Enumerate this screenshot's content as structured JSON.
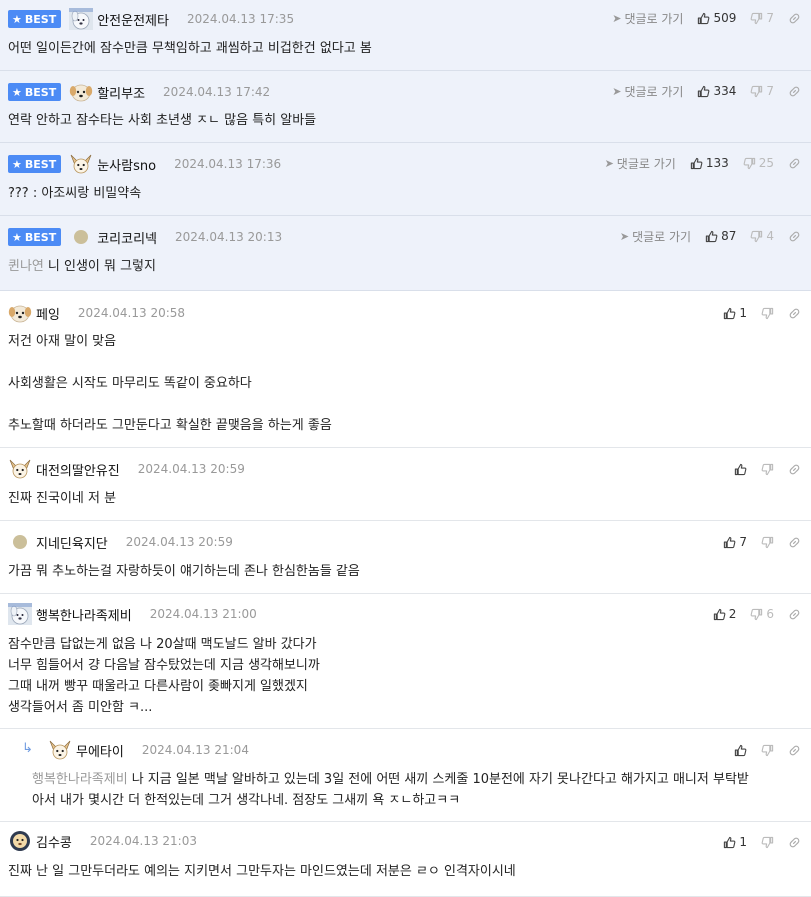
{
  "labels": {
    "best": "BEST",
    "reply_link": "댓글로 가기"
  },
  "comments": [
    {
      "nick": "안전운전제타",
      "time": "2024.04.13 17:35",
      "up": "509",
      "down": "7",
      "avatar": "white-dog",
      "lines": [
        "어떤 일이든간에 잠수만큼 무책임하고 괘씸하고 비겁한건 없다고 봄"
      ]
    },
    {
      "nick": "할리부조",
      "time": "2024.04.13 17:42",
      "up": "334",
      "down": "7",
      "avatar": "puppy",
      "lines": [
        "연락 안하고 잠수타는 사회 초년생 ㅈㄴ 많음 특히 알바들"
      ]
    },
    {
      "nick": "눈사람sno",
      "time": "2024.04.13 17:36",
      "up": "133",
      "down": "25",
      "avatar": "fennec",
      "lines": [
        "??? : 아조씨랑 비밀약속"
      ]
    },
    {
      "nick": "코리코리넥",
      "time": "2024.04.13 20:13",
      "up": "87",
      "down": "4",
      "avatar": "dot",
      "mention": "퀸나연",
      "lines": [
        "니 인생이 뭐 그렇지"
      ]
    },
    {
      "nick": "페잉",
      "time": "2024.04.13 20:58",
      "up": "1",
      "down": "",
      "avatar": "puppy",
      "lines": [
        "저건 아재 말이 맞음",
        "",
        "사회생활은 시작도 마무리도 똑같이 중요하다",
        "",
        "추노할때 하더라도 그만둔다고 확실한 끝맺음을 하는게 좋음"
      ]
    },
    {
      "nick": "대전의딸안유진",
      "time": "2024.04.13 20:59",
      "up": "",
      "down": "",
      "avatar": "fennec",
      "lines": [
        "진짜 진국이네 저 분"
      ]
    },
    {
      "nick": "지네딘육지단",
      "time": "2024.04.13 20:59",
      "up": "7",
      "down": "",
      "avatar": "dot",
      "lines": [
        "가끔 뭐 추노하는걸 자랑하듯이 얘기하는데 존나 한심한놈들 같음"
      ]
    },
    {
      "nick": "행복한나라족제비",
      "time": "2024.04.13 21:00",
      "up": "2",
      "down": "6",
      "avatar": "white-dog",
      "lines": [
        "잠수만큼 답없는게 없음 나 20살때 맥도날드 알바 갔다가",
        "너무 힘들어서 걍 다음날 잠수탔었는데 지금 생각해보니까",
        "그때 내꺼 빵꾸 때울라고 다른사람이 좆빠지게 일했겠지",
        "생각들어서 좀 미안함 ㅋ..."
      ]
    },
    {
      "nick": "무에타이",
      "time": "2024.04.13 21:04",
      "up": "",
      "down": "",
      "avatar": "fennec",
      "reply": true,
      "mention": "행복한나라족제비",
      "lines": [
        "나 지금 일본 맥날 알바하고 있는데 3일 전에 어떤 새끼 스케줄 10분전에 자기 못나간다고 해가지고 매니저 부탁받",
        "아서 내가 몇시간 더 한적있는데 그거 생각나네. 점장도 그새끼 욕 ㅈㄴ하고ㅋㅋ"
      ]
    },
    {
      "nick": "김수콩",
      "time": "2024.04.13 21:03",
      "up": "1",
      "down": "",
      "avatar": "lion",
      "lines": [
        "진짜 난 일 그만두더라도 예의는 지키면서 그만두자는 마인드였는데 저분은 ㄹㅇ 인격자이시네"
      ]
    }
  ]
}
